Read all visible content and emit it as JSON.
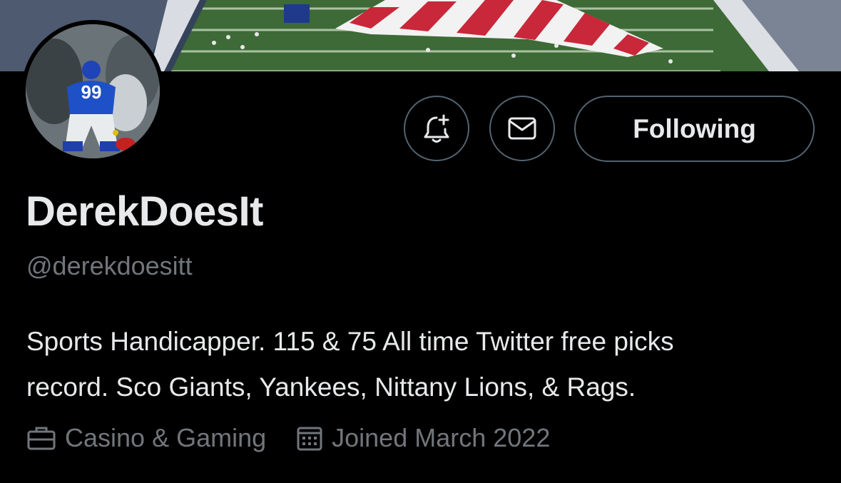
{
  "profile": {
    "display_name": "DerekDoesIt",
    "handle": "@derekdoesitt",
    "bio_lines": [
      "Sports Handicapper. 115 & 75 All time Twitter free picks",
      "record. Sco Giants, Yankees, Nittany Lions, & Rags."
    ],
    "category": "Casino & Gaming",
    "joined": "Joined March 2022",
    "avatar_jersey_number": "99"
  },
  "actions": {
    "follow_label": "Following",
    "notify_icon": "bell-plus-icon",
    "message_icon": "envelope-icon"
  },
  "meta_icons": {
    "category_icon": "briefcase-icon",
    "joined_icon": "calendar-icon"
  },
  "colors": {
    "background": "#000000",
    "primary_text": "#e7e9ea",
    "secondary_text": "#71767b",
    "button_border": "#536471"
  }
}
